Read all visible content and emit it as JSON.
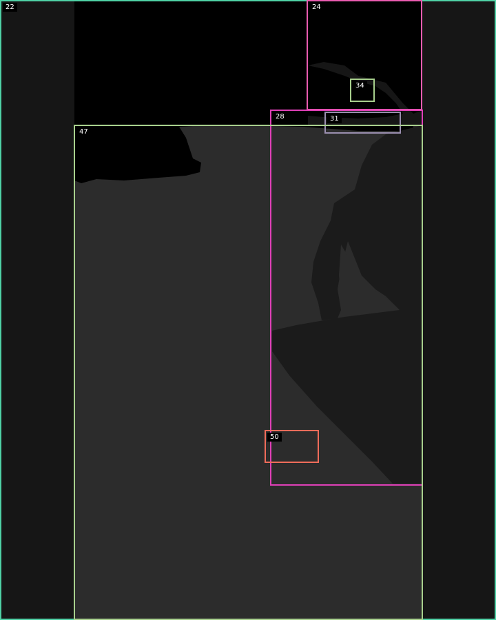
{
  "colors": {
    "background": "#161616",
    "gray_panel": "#2c2c2c",
    "black_region": "#000000",
    "dark_silhouette": "#1b1b1b"
  },
  "regions": [
    {
      "id": "22",
      "color": "#4fd1a5"
    },
    {
      "id": "24",
      "color": "#e95bb0"
    },
    {
      "id": "34",
      "color": "#a8d08d"
    },
    {
      "id": "28",
      "color": "#e040b8"
    },
    {
      "id": "31",
      "color": "#9b8fb0"
    },
    {
      "id": "47",
      "color": "#a8d08d"
    },
    {
      "id": "50",
      "color": "#f06c5a"
    }
  ]
}
